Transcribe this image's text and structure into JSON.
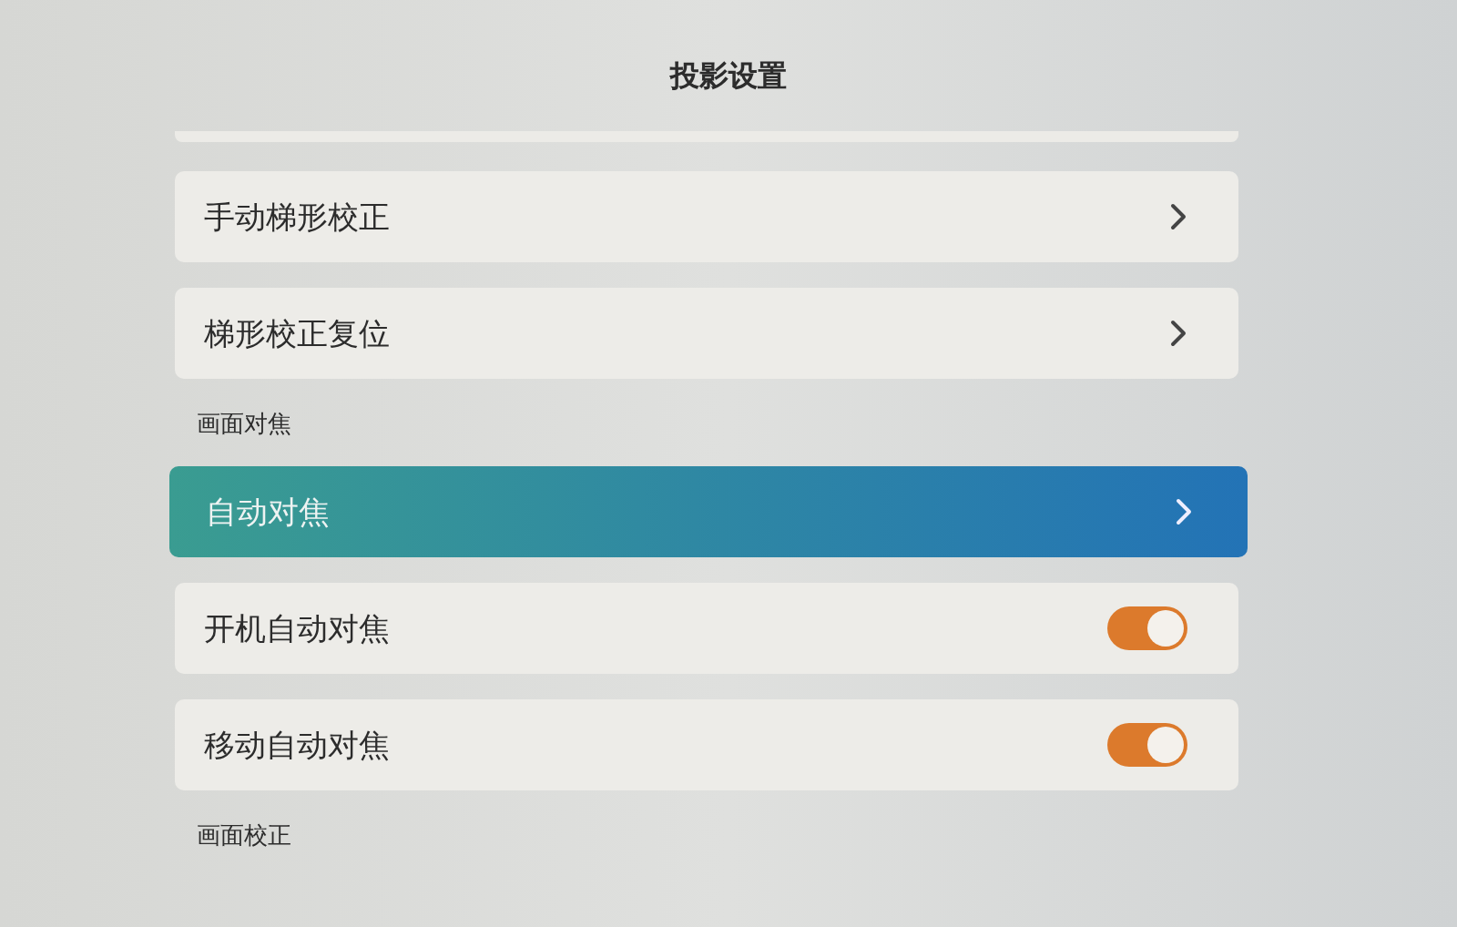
{
  "title": "投影设置",
  "items": [
    {
      "kind": "nav",
      "label": "手动梯形校正",
      "selected": false
    },
    {
      "kind": "nav",
      "label": "梯形校正复位",
      "selected": false
    },
    {
      "kind": "header",
      "label": "画面对焦"
    },
    {
      "kind": "nav",
      "label": "自动对焦",
      "selected": true
    },
    {
      "kind": "toggle",
      "label": "开机自动对焦",
      "on": true
    },
    {
      "kind": "toggle",
      "label": "移动自动对焦",
      "on": true
    },
    {
      "kind": "header",
      "label": "画面校正"
    }
  ]
}
